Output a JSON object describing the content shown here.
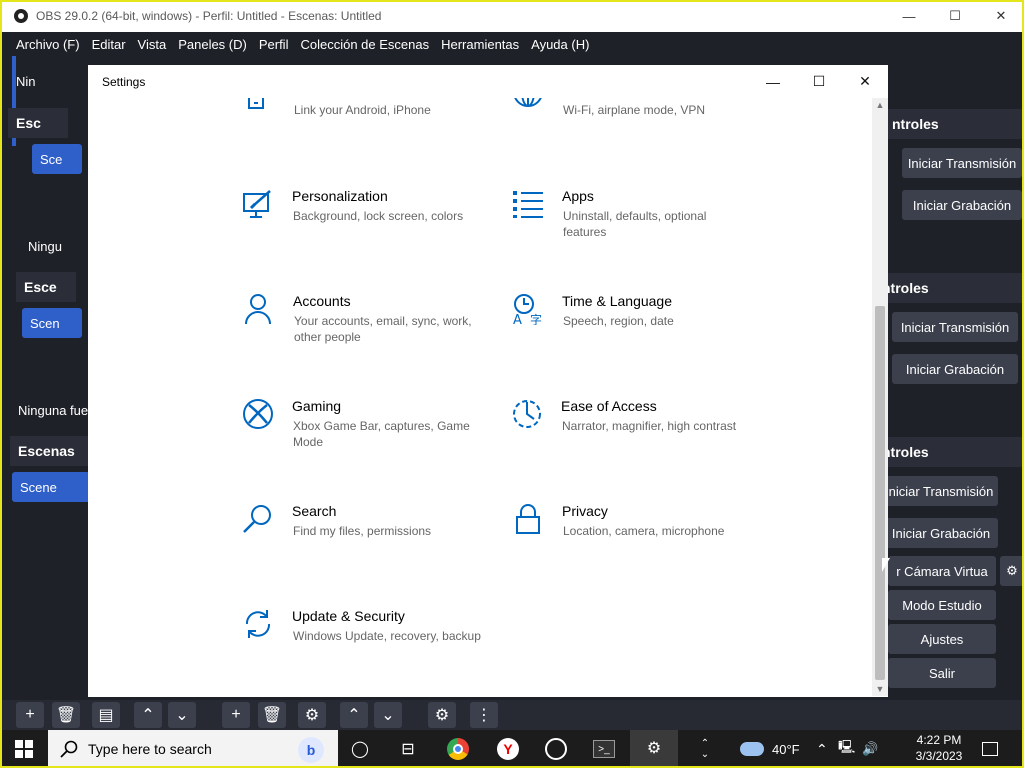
{
  "obs": {
    "window_title": "OBS 29.0.2 (64-bit, windows) - Perfil: Untitled - Escenas: Untitled",
    "win_min": "—",
    "win_max": "☐",
    "win_close": "✕",
    "menu": [
      "Archivo (F)",
      "Editar",
      "Vista",
      "Paneles (D)",
      "Perfil",
      "Colección de Escenas",
      "Herramientas",
      "Ayuda (H)"
    ],
    "left_dock": {
      "ninguna_short": "Nin",
      "esc_short": "Esc",
      "scene_short": "Sce",
      "ninguna_2": "Ningu",
      "escenas_2": "Esce",
      "scene_2": "Scen",
      "ninguna_fuente": "Ninguna fue",
      "escenas_header": "Escenas",
      "scene_item": "Scene"
    },
    "right_dock": {
      "controles_1": "ntroles",
      "iniciar_transmision_1": "Iniciar Transmisión",
      "iniciar_grabacion_1": "Iniciar Grabación",
      "controles_2": "ntroles",
      "iniciar_transmision_2": "Iniciar Transmisión",
      "iniciar_grabacion_2": "Iniciar Grabación",
      "controles_3": "ntroles",
      "iniciar_transmision_3": "niciar Transmisión",
      "iniciar_grabacion_3": "Iniciar Grabación",
      "camara_virtual": "r Cámara Virtua",
      "modo_estudio": "Modo Estudio",
      "ajustes": "Ajustes",
      "salir": "Salir"
    }
  },
  "settings": {
    "title": "Settings",
    "tiles": [
      {
        "name": "phone",
        "title": "",
        "desc": "Link your Android, iPhone"
      },
      {
        "name": "network",
        "title": "",
        "desc": "Wi-Fi, airplane mode, VPN"
      },
      {
        "name": "personalization",
        "title": "Personalization",
        "desc": "Background, lock screen, colors"
      },
      {
        "name": "apps",
        "title": "Apps",
        "desc": "Uninstall, defaults, optional features"
      },
      {
        "name": "accounts",
        "title": "Accounts",
        "desc": "Your accounts, email, sync, work, other people"
      },
      {
        "name": "time-language",
        "title": "Time & Language",
        "desc": "Speech, region, date"
      },
      {
        "name": "gaming",
        "title": "Gaming",
        "desc": "Xbox Game Bar, captures, Game Mode"
      },
      {
        "name": "ease-of-access",
        "title": "Ease of Access",
        "desc": "Narrator, magnifier, high contrast"
      },
      {
        "name": "search",
        "title": "Search",
        "desc": "Find my files, permissions"
      },
      {
        "name": "privacy",
        "title": "Privacy",
        "desc": "Location, camera, microphone"
      },
      {
        "name": "update-security",
        "title": "Update & Security",
        "desc": "Windows Update, recovery, backup"
      }
    ]
  },
  "taskbar": {
    "search_placeholder": "Type here to search",
    "temperature": "40°F",
    "time": "4:22 PM",
    "date": "3/3/2023"
  },
  "colors": {
    "accent": "#0067c0",
    "obs_bg": "#1f2128",
    "obs_button": "#3c404d",
    "obs_scene": "#2f5fc9"
  }
}
